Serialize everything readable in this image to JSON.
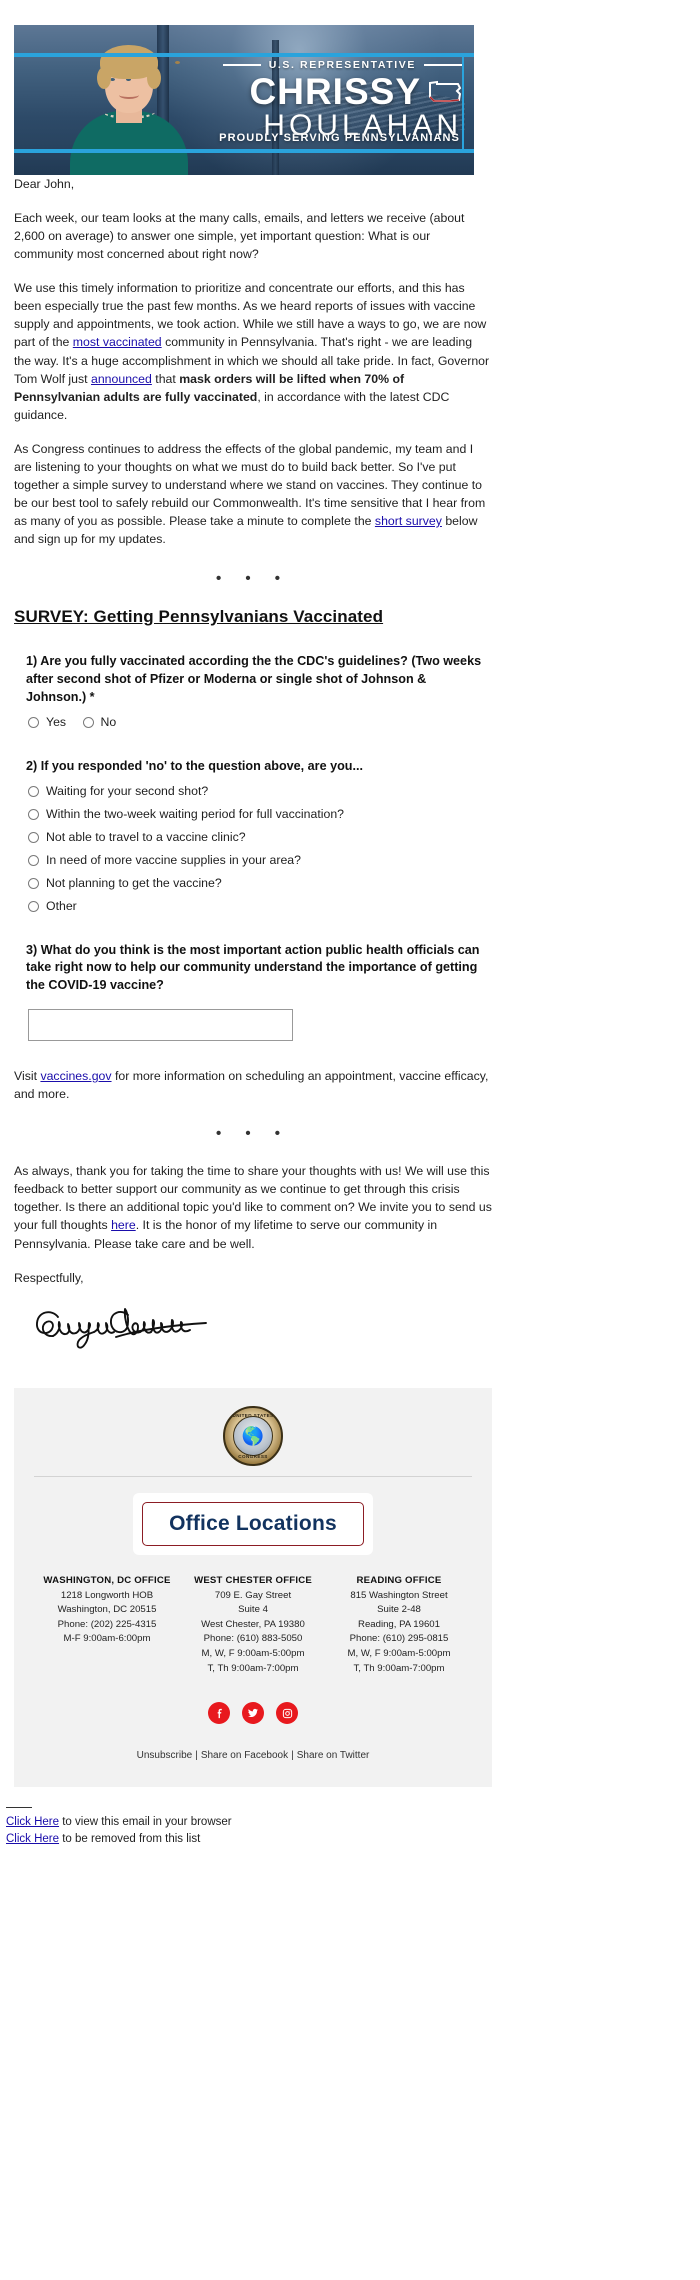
{
  "banner": {
    "eyebrow": "U.S. REPRESENTATIVE",
    "first_name": "CHRISSY",
    "last_name": "HOULAHAN",
    "tagline": "PROUDLY SERVING PENNSYLVANIANS",
    "accent_color": "#2aa3dc",
    "bg_color": "#1b3350"
  },
  "letter": {
    "greeting": "Dear John,",
    "p1": "Each week, our team looks at the many calls, emails, and letters we receive (about 2,600 on average) to answer one simple, yet important question: What is our community most concerned about right now?",
    "p2_a": "We use this timely information to prioritize and concentrate our efforts, and this has been especially true the past few months. As we heard reports of issues with vaccine supply and appointments, we took action. While we still have a ways to go, we are now part of the ",
    "p2_link1": "most vaccinated",
    "p2_b": " community in Pennsylvania. That's right - we are leading the way. It's a huge accomplishment in which we should all take pride. In fact, Governor Tom Wolf just ",
    "p2_link2": "announced",
    "p2_c": " that ",
    "p2_bold": "mask orders will be lifted when 70% of Pennsylvanian adults are fully vaccinated",
    "p2_d": ", in accordance with the latest CDC guidance.",
    "p3_a": "As Congress continues to address the effects of the global pandemic, my team and I are listening to your thoughts on what we must do to build back better. So I've put together a simple survey to understand where we stand on vaccines. They continue to be our best tool to safely rebuild our Commonwealth. It's time sensitive that I hear from as many of you as possible. Please take a minute to complete the ",
    "p3_link": "short survey",
    "p3_b": " below and sign up for my updates.",
    "divider_dots": "• • •"
  },
  "survey": {
    "title": "SURVEY: Getting Pennsylvanians Vaccinated",
    "q1": {
      "text": "1) Are you fully vaccinated according the the CDC's guidelines? (Two weeks after second shot of Pfizer or Moderna or single shot of Johnson & Johnson.) *",
      "options": [
        "Yes",
        "No"
      ]
    },
    "q2": {
      "text": "2) If you responded 'no' to the question above, are you...",
      "options": [
        "Waiting for your second shot?",
        "Within the two-week waiting period for full vaccination?",
        "Not able to travel to a vaccine clinic?",
        "In need of more vaccine supplies in your area?",
        "Not planning to get the vaccine?",
        "Other"
      ]
    },
    "q3": {
      "text": "3) What do you think is the most important action public health officials can take right now to help our community understand the importance of getting the COVID-19 vaccine?",
      "answer_value": "",
      "answer_placeholder": ""
    }
  },
  "vaccines_note": {
    "before": "Visit ",
    "link": "vaccines.gov",
    "after": " for more information on scheduling an appointment, vaccine efficacy, and more."
  },
  "closing": {
    "p_a": "As always, thank you for taking the time to share your thoughts with us! We will use this feedback to better support our community as we continue to get through this crisis together. Is there an additional topic you'd like to comment on? We invite you to send us your full thoughts ",
    "p_link": "here",
    "p_b": ". It is the honor of my lifetime to serve our community in Pennsylvania. Please take care and be well.",
    "signoff": "Respectfully,",
    "signature_name": "Chrissy Houlahan"
  },
  "footer": {
    "seal_top_text": "UNITED STATES",
    "seal_bottom_text": "CONGRESS",
    "office_locations_label": "Office Locations",
    "offices": [
      {
        "name": "WASHINGTON, DC OFFICE",
        "lines": [
          "1218 Longworth HOB",
          "Washington, DC 20515",
          "Phone: (202) 225-4315",
          "M-F 9:00am-6:00pm"
        ]
      },
      {
        "name": "WEST CHESTER OFFICE",
        "lines": [
          "709 E. Gay Street",
          "Suite 4",
          "West Chester, PA 19380",
          "Phone: (610) 883-5050",
          "M, W, F 9:00am-5:00pm",
          "T, Th 9:00am-7:00pm"
        ]
      },
      {
        "name": "READING OFFICE",
        "lines": [
          "815 Washington Street",
          "Suite 2-48",
          "Reading, PA 19601",
          "Phone: (610) 295-0815",
          "M, W, F 9:00am-5:00pm",
          "T, Th 9:00am-7:00pm"
        ]
      }
    ],
    "social": [
      {
        "name": "facebook",
        "glyph": "f"
      },
      {
        "name": "twitter",
        "glyph": "t"
      },
      {
        "name": "instagram",
        "glyph": "i"
      }
    ],
    "links": [
      "Unsubscribe",
      "Share on Facebook",
      "Share on Twitter"
    ],
    "link_separator": "|",
    "social_color": "#e8191e"
  },
  "bottom": {
    "browser_link": "Click Here",
    "browser_text": " to view this email in your browser",
    "unsub_link": "Click Here",
    "unsub_text": " to be removed from this list"
  }
}
